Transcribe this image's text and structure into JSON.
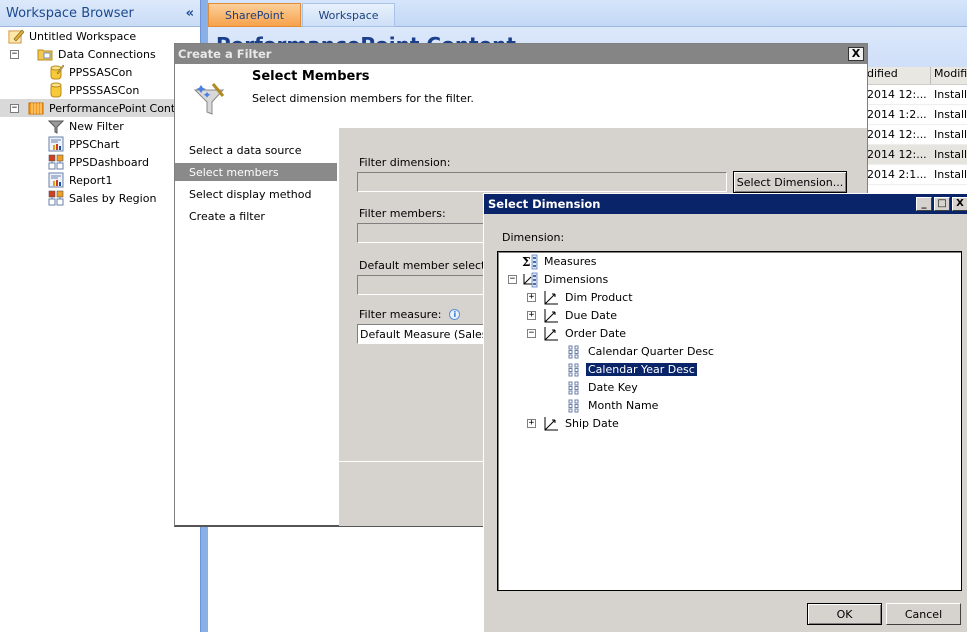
{
  "workspace_browser": {
    "title": "Workspace Browser",
    "collapse_glyph": "«",
    "items": [
      {
        "label": "Untitled Workspace",
        "icon": "workspace-icon",
        "level": 0
      },
      {
        "label": "Data Connections",
        "icon": "folder-icon",
        "level": 0,
        "expander": "−"
      },
      {
        "label": "PPSSASCon",
        "icon": "database-edit-icon",
        "level": 1
      },
      {
        "label": "PPSSSASCon",
        "icon": "database-icon",
        "level": 1
      },
      {
        "label": "PerformancePoint Content",
        "icon": "content-folder-icon",
        "level": 0,
        "expander": "−",
        "selected": true
      },
      {
        "label": "New Filter",
        "icon": "filter-icon",
        "level": 1
      },
      {
        "label": "PPSChart",
        "icon": "report-icon",
        "level": 1
      },
      {
        "label": "PPSDashboard",
        "icon": "dashboard-icon",
        "level": 1
      },
      {
        "label": "Report1",
        "icon": "report-icon",
        "level": 1
      },
      {
        "label": "Sales by Region",
        "icon": "dashboard-icon",
        "level": 1
      }
    ]
  },
  "tabs": [
    {
      "label": "SharePoint",
      "active": true
    },
    {
      "label": "Workspace",
      "active": false
    }
  ],
  "page_title": "PerformancePoint Content",
  "grid": {
    "headers": [
      "dified",
      "Modifi"
    ],
    "rows": [
      [
        "2014 12:...",
        "Installa"
      ],
      [
        "2014 1:2...",
        "Installa"
      ],
      [
        "2014 12:...",
        "Installa"
      ],
      [
        "2014 12:...",
        "Installa"
      ],
      [
        "2014 2:1...",
        "Installa"
      ]
    ]
  },
  "create_filter": {
    "title": "Create a Filter",
    "close_glyph": "X",
    "heading": "Select Members",
    "subheading": "Select dimension members for the filter.",
    "steps": [
      {
        "label": "Select a data source",
        "active": false
      },
      {
        "label": "Select members",
        "active": true
      },
      {
        "label": "Select display method",
        "active": false
      },
      {
        "label": "Create a filter",
        "active": false
      }
    ],
    "fields": {
      "filter_dimension_label": "Filter dimension:",
      "filter_dimension_value": "",
      "select_dimension_button": "Select Dimension...",
      "filter_members_label": "Filter members:",
      "filter_members_value": "",
      "default_member_label": "Default member selection",
      "default_member_value": "",
      "filter_measure_label": "Filter measure:",
      "filter_measure_value": "Default Measure (Sales Amount)",
      "info_glyph": "i"
    }
  },
  "select_dimension": {
    "title": "Select Dimension",
    "minimize_glyph": "_",
    "maximize_glyph": "□",
    "close_glyph": "X",
    "dimension_label": "Dimension:",
    "tree": [
      {
        "label": "Measures",
        "icon": "measures-icon",
        "level": 0
      },
      {
        "label": "Dimensions",
        "icon": "dimensions-icon",
        "level": 0,
        "expander": "−"
      },
      {
        "label": "Dim Product",
        "icon": "dimension-icon",
        "level": 1,
        "expander": "+"
      },
      {
        "label": "Due Date",
        "icon": "dimension-icon",
        "level": 1,
        "expander": "+"
      },
      {
        "label": "Order Date",
        "icon": "dimension-icon",
        "level": 1,
        "expander": "−"
      },
      {
        "label": "Calendar Quarter Desc",
        "icon": "attribute-icon",
        "level": 2
      },
      {
        "label": "Calendar Year Desc",
        "icon": "attribute-icon",
        "level": 2,
        "selected": true
      },
      {
        "label": "Date Key",
        "icon": "attribute-icon",
        "level": 2
      },
      {
        "label": "Month Name",
        "icon": "attribute-icon",
        "level": 2
      },
      {
        "label": "Ship Date",
        "icon": "dimension-icon",
        "level": 1,
        "expander": "+"
      }
    ],
    "ok_label": "OK",
    "cancel_label": "Cancel"
  },
  "colors": {
    "active_title": "#0a246a",
    "inactive_title": "#858585",
    "sharepoint_tab": "#f7a24b",
    "dialog_bg": "#d6d3ce"
  }
}
